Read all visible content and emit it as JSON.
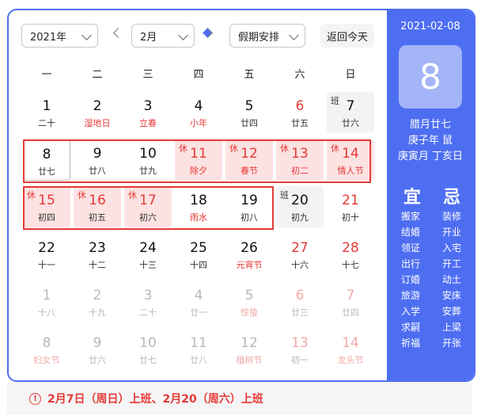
{
  "controls": {
    "year": "2021年",
    "month": "2月",
    "holiday": "假期安排",
    "today_button": "返回今天"
  },
  "weekdays": [
    "一",
    "二",
    "三",
    "四",
    "五",
    "六",
    "日"
  ],
  "days": [
    {
      "d": "1",
      "l": "二十"
    },
    {
      "d": "2",
      "l": "湿地日",
      "lc": "red"
    },
    {
      "d": "3",
      "l": "立春",
      "lc": "red"
    },
    {
      "d": "4",
      "l": "小年",
      "lc": "red"
    },
    {
      "d": "5",
      "l": "廿四"
    },
    {
      "d": "6",
      "l": "廿五",
      "dc": "red"
    },
    {
      "d": "7",
      "l": "廿六",
      "tag": "班",
      "kind": "work"
    },
    {
      "d": "8",
      "l": "廿七",
      "selected": true
    },
    {
      "d": "9",
      "l": "廿八"
    },
    {
      "d": "10",
      "l": "廿九"
    },
    {
      "d": "11",
      "l": "除夕",
      "tag": "休",
      "kind": "rest",
      "dc": "red",
      "lc": "red"
    },
    {
      "d": "12",
      "l": "春节",
      "tag": "休",
      "kind": "rest",
      "dc": "red",
      "lc": "red"
    },
    {
      "d": "13",
      "l": "初二",
      "tag": "休",
      "kind": "rest",
      "dc": "red",
      "lc": "red"
    },
    {
      "d": "14",
      "l": "情人节",
      "tag": "休",
      "kind": "rest",
      "dc": "red",
      "lc": "red"
    },
    {
      "d": "15",
      "l": "初四",
      "tag": "休",
      "kind": "rest",
      "dc": "red"
    },
    {
      "d": "16",
      "l": "初五",
      "tag": "休",
      "kind": "rest",
      "dc": "red"
    },
    {
      "d": "17",
      "l": "初六",
      "tag": "休",
      "kind": "rest",
      "dc": "red"
    },
    {
      "d": "18",
      "l": "雨水",
      "lc": "red"
    },
    {
      "d": "19",
      "l": "初八"
    },
    {
      "d": "20",
      "l": "初九",
      "tag": "班",
      "kind": "work"
    },
    {
      "d": "21",
      "l": "初十",
      "dc": "red"
    },
    {
      "d": "22",
      "l": "十一"
    },
    {
      "d": "23",
      "l": "十二"
    },
    {
      "d": "24",
      "l": "十三"
    },
    {
      "d": "25",
      "l": "十四"
    },
    {
      "d": "26",
      "l": "元宵节",
      "lc": "red"
    },
    {
      "d": "27",
      "l": "十六",
      "dc": "red"
    },
    {
      "d": "28",
      "l": "十七",
      "dc": "red"
    },
    {
      "d": "1",
      "l": "十八",
      "dim": true
    },
    {
      "d": "2",
      "l": "十九",
      "dim": true
    },
    {
      "d": "3",
      "l": "二十",
      "dim": true
    },
    {
      "d": "4",
      "l": "廿一",
      "dim": true
    },
    {
      "d": "5",
      "l": "惊蛰",
      "dim": true,
      "lc": "red"
    },
    {
      "d": "6",
      "l": "廿三",
      "dim": true,
      "dc": "red"
    },
    {
      "d": "7",
      "l": "廿四",
      "dim": true,
      "dc": "red"
    },
    {
      "d": "8",
      "l": "妇女节",
      "dim": true,
      "lc": "red"
    },
    {
      "d": "9",
      "l": "廿六",
      "dim": true
    },
    {
      "d": "10",
      "l": "廿七",
      "dim": true
    },
    {
      "d": "11",
      "l": "廿八",
      "dim": true
    },
    {
      "d": "12",
      "l": "植树节",
      "dim": true,
      "lc": "red"
    },
    {
      "d": "13",
      "l": "初一",
      "dim": true,
      "dc": "red"
    },
    {
      "d": "14",
      "l": "龙头节",
      "dim": true,
      "dc": "red",
      "lc": "red"
    }
  ],
  "side": {
    "date": "2021-02-08",
    "day": "8",
    "lunar": "腊月廿七",
    "year_gz": "庚子年 鼠",
    "month_day_gz": "庚寅月 丁亥日",
    "yi_title": "宜",
    "ji_title": "忌",
    "yi": [
      "搬家",
      "结婚",
      "领证",
      "出行",
      "订婚",
      "旅游",
      "入学",
      "求嗣",
      "祈福"
    ],
    "ji": [
      "装修",
      "开业",
      "入宅",
      "开工",
      "动土",
      "安床",
      "安葬",
      "上梁",
      "开张"
    ]
  },
  "notice": "2月7日（周日）上班、2月20（周六）上班"
}
